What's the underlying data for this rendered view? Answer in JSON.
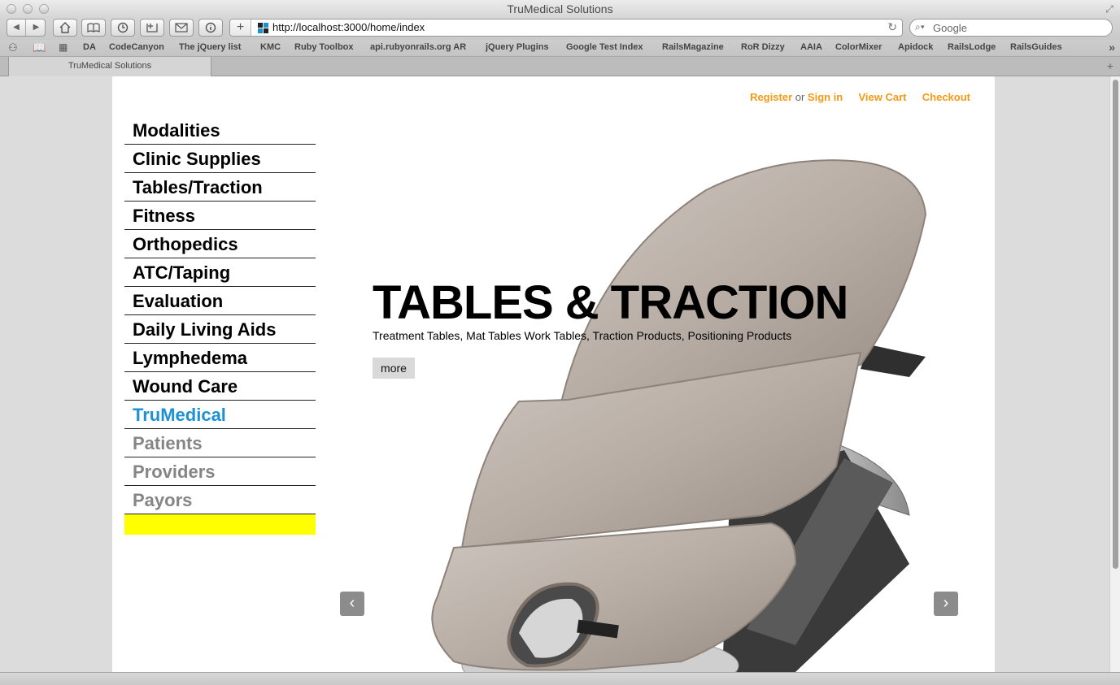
{
  "window": {
    "title": "TruMedical Solutions"
  },
  "toolbar": {
    "back_icon": "back-icon",
    "forward_icon": "forward-icon",
    "url": "http://localhost:3000/home/index",
    "search_placeholder": "Google"
  },
  "bookmarks": [
    "DA",
    "CodeCanyon",
    "The jQuery list",
    "KMC",
    "Ruby Toolbox",
    "api.rubyonrails.org AR",
    "jQuery Plugins",
    "Google Test Index",
    "RailsMagazine",
    "RoR Dizzy",
    "AAIA",
    "ColorMixer",
    "Apidock",
    "RailsLodge",
    "RailsGuides"
  ],
  "tab": {
    "label": "TruMedical Solutions"
  },
  "header": {
    "register": "Register",
    "or": "or",
    "sign_in": "Sign in",
    "view_cart": "View Cart",
    "checkout": "Checkout"
  },
  "nav": {
    "items": [
      "Modalities",
      "Clinic Supplies",
      "Tables/Traction",
      "Fitness",
      "Orthopedics",
      "ATC/Taping",
      "Evaluation",
      "Daily Living Aids",
      "Lymphedema",
      "Wound Care"
    ],
    "highlight": "TruMedical",
    "secondary": [
      "Patients",
      "Providers",
      "Payors"
    ]
  },
  "hero": {
    "title": "TABLES & TRACTION",
    "subtitle": "Treatment Tables, Mat Tables Work Tables, Traction Products, Positioning Products",
    "more": "more",
    "prev": "‹",
    "next": "›"
  },
  "colors": {
    "link_orange": "#f49a15",
    "highlight_blue": "#1e90d6",
    "nav_gray": "#858585",
    "accent_yellow": "#ffff00"
  }
}
